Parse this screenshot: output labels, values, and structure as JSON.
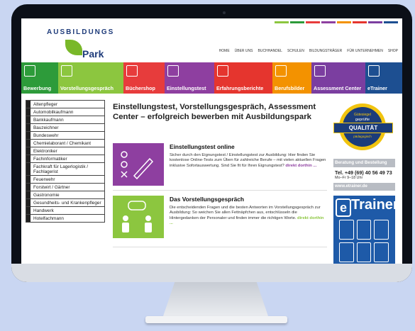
{
  "logo": {
    "word": "AUSBILDUNGS",
    "park": "Park"
  },
  "colorbar": [
    "#8cc63f",
    "#2d9b3a",
    "#e73c3c",
    "#8e3fa0",
    "#f39200",
    "#e5352e",
    "#7b3ea0",
    "#1d4f91"
  ],
  "topnav": [
    "HOME",
    "ÜBER UNS",
    "BUCHHANDEL",
    "SCHULEN",
    "BILDUNGSTRÄGER",
    "FÜR UNTERNEHMEN",
    "SHOP"
  ],
  "tabs": [
    {
      "label": "Bewerbung",
      "color": "#2d9b3a"
    },
    {
      "label": "Vorstellungsgespräch",
      "color": "#8cc63f"
    },
    {
      "label": "Büchershop",
      "color": "#e73c3c"
    },
    {
      "label": "Einstellungstest",
      "color": "#8e3fa0"
    },
    {
      "label": "Erfahrungsberichte",
      "color": "#e5352e"
    },
    {
      "label": "Berufsbilder",
      "color": "#f39200"
    },
    {
      "label": "Assessment Center",
      "color": "#7b3ea0"
    },
    {
      "label": "eTrainer",
      "color": "#1d4f91"
    }
  ],
  "sidebar": [
    "Altenpfleger",
    "Automobilkaufmann",
    "Bankkaufmann",
    "Bauzeichner",
    "Bundeswehr",
    "Chemielaborant / Chemikant",
    "Elektroniker",
    "Fachinformatiker",
    "Fachkraft für Lagerlogistik / Fachlagerist",
    "Feuerwehr",
    "Forstwirt / Gärtner",
    "Gastronomie",
    "Gesundheits- und Krankenpfleger",
    "Handwerk",
    "Hotelfachmann"
  ],
  "main": {
    "headline": "Einstellungstest, Vorstellungsgespräch, Assessment Center – erfolgreich bewerben mit Ausbildungspark",
    "cards": [
      {
        "title": "Einstellungstest online",
        "text": "Sicher durch den Eignungstest / Einstellungstest zur Ausbildung: Hier finden Sie kostenlose Online-Tests zum Üben für zahlreiche Berufe – mit vielen aktuellen Fragen inklusive Sofortauswertung. Sind Sie fit für Ihren Eignungstest?",
        "more": "direkt dorthin ...",
        "color": "#8e3fa0",
        "moreColor": "#8e3fa0"
      },
      {
        "title": "Das Vorstellungsgespräch",
        "text": "Die entscheidenden Fragen und die besten Antworten im Vorstellungsgespräch zur Ausbildung: So weichen Sie allen Fettnäpfchen aus, entschlüsseln die Hintergedanken der Personaler und finden immer die richtigen Worte.",
        "more": "direkt dorthin ...",
        "color": "#8cc63f",
        "moreColor": "#8cc63f"
      }
    ]
  },
  "right": {
    "seal_top": "Gütesiegel",
    "seal_mid": "geprüfte",
    "seal_ribbon": "QUALITÄT",
    "seal_bot": "pädagogisch",
    "beratung": "Beratung und Bestellung",
    "tel": "Tel. +49 (69) 40 56 49 73",
    "hours": "Mo–Fr 9–18 Uhr",
    "etrainer_link": "www.etrainer.de",
    "etrainer_e": "e",
    "etrainer_text": "Trainer"
  }
}
